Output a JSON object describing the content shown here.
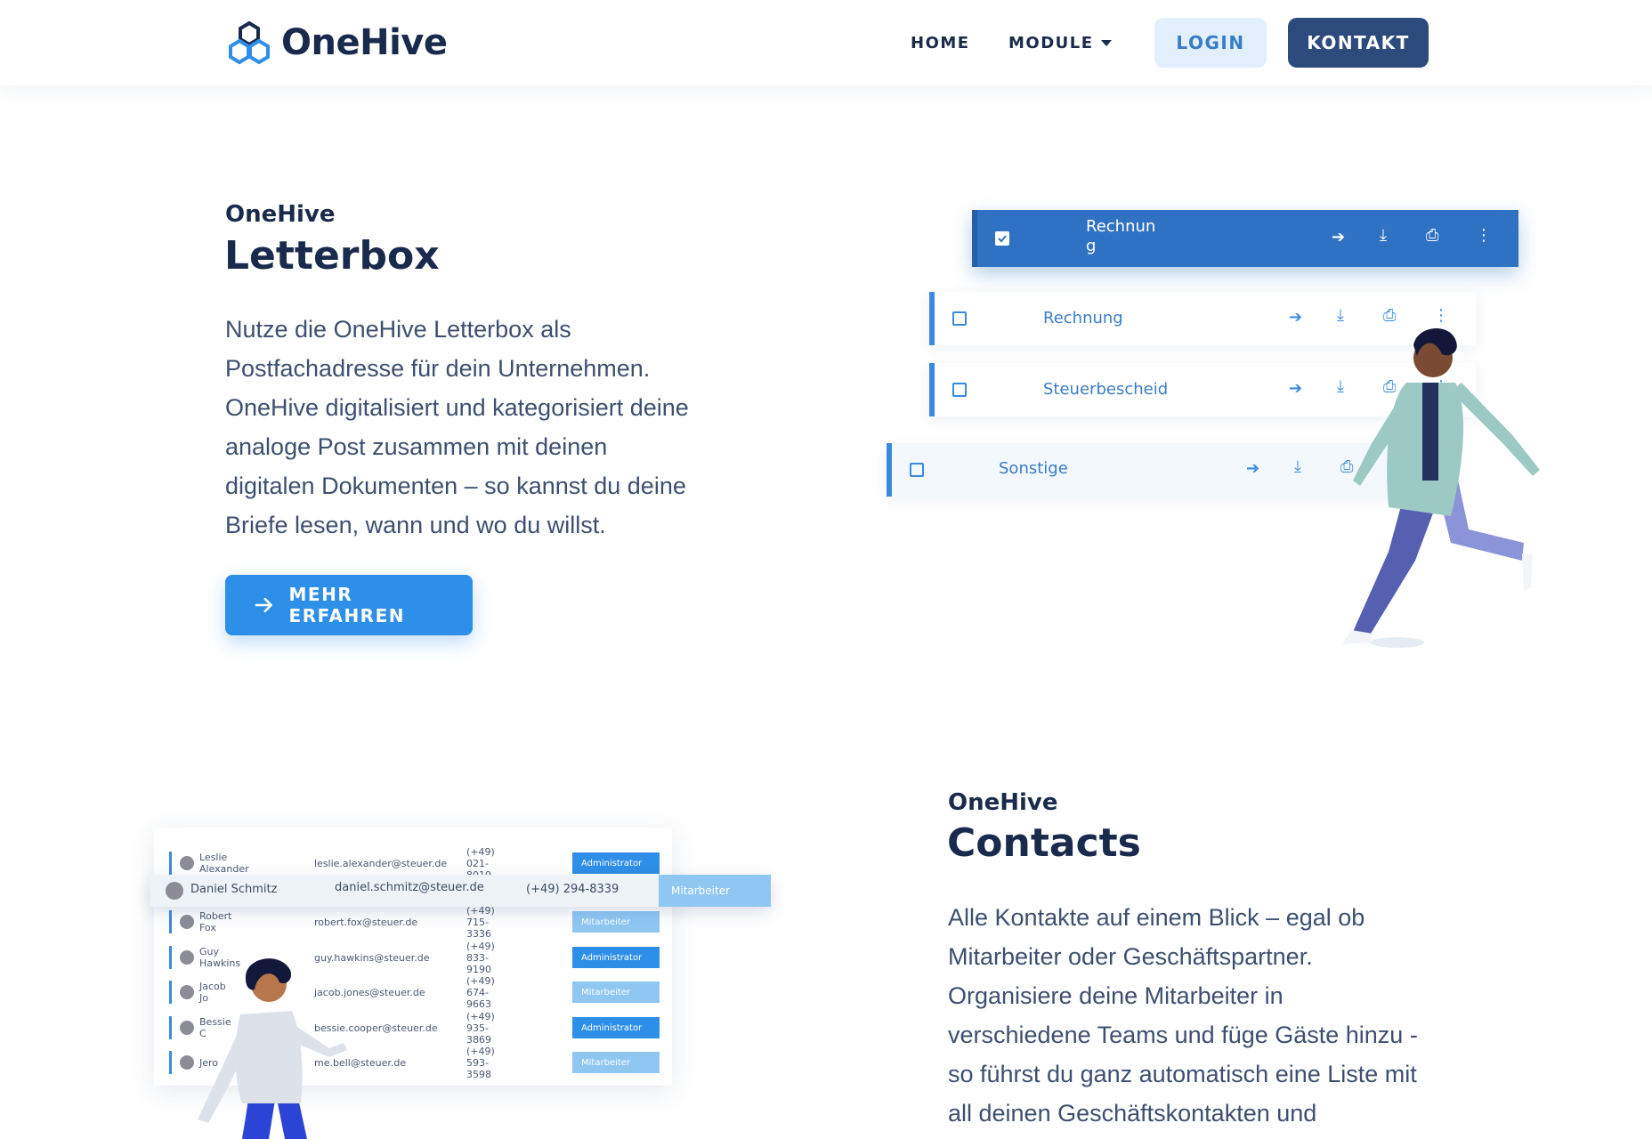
{
  "header": {
    "logo_text": "OneHive",
    "nav": {
      "home": "HOME",
      "module": "MODULE"
    },
    "login": "LOGIN",
    "kontakt": "KONTAKT"
  },
  "letterbox": {
    "eyebrow": "OneHive",
    "title": "Letterbox",
    "lines": [
      "Nutze die OneHive Letterbox als",
      "Postfachadresse für dein Unternehmen.",
      "OneHive digitalisiert und kategorisiert deine",
      "analoge Post zusammen mit deinen",
      "digitalen Dokumenten – so kannst du deine",
      "Briefe lesen, wann und wo du willst."
    ],
    "cta": "MEHR ERFAHREN",
    "docs": {
      "active_line1": "Rechnun",
      "active_line2": "g",
      "row2": "Rechnung",
      "row3": "Steuerbescheid",
      "row4": "Sonstige"
    }
  },
  "contacts": {
    "eyebrow": "OneHive",
    "title": "Contacts",
    "lines": [
      "Alle Kontakte auf einem Blick – egal ob",
      "Mitarbeiter oder Geschäftspartner.",
      "Organisiere deine Mitarbeiter in",
      "verschiedene Teams und füge Gäste hinzu -",
      "so führst du ganz automatisch eine Liste mit",
      "all deinen Geschäftskontakten und"
    ],
    "table": [
      {
        "name": "Leslie Alexander",
        "email": "leslie.alexander@steuer.de",
        "phone": "(+49) 021-8019",
        "role": "Administrator"
      },
      {
        "name": "Robert Fox",
        "email": "robert.fox@steuer.de",
        "phone": "(+49) 715-3336",
        "role": "Mitarbeiter"
      },
      {
        "name": "Guy Hawkins",
        "email": "guy.hawkins@steuer.de",
        "phone": "(+49) 833-9190",
        "role": "Administrator"
      },
      {
        "name": "Jacob Jo",
        "email": "jacob.jones@steuer.de",
        "phone": "(+49) 674-9663",
        "role": "Mitarbeiter"
      },
      {
        "name": "Bessie C",
        "email": "bessie.cooper@steuer.de",
        "phone": "(+49) 935-3869",
        "role": "Administrator"
      },
      {
        "name": "Jero",
        "email": "me.bell@steuer.de",
        "phone": "(+49) 593-3598",
        "role": "Mitarbeiter"
      }
    ],
    "highlight": {
      "name": "Daniel Schmitz",
      "email": "daniel.schmitz@steuer.de",
      "phone": "(+49) 294-8339",
      "role": "Mitarbeiter"
    }
  },
  "colors": {
    "primary": "#2e8fe8",
    "navy": "#1a2a4c",
    "kontakt_bg": "#2c4a7c",
    "login_bg": "#e2effc"
  },
  "icons": [
    "onehive-logo-icon",
    "caret-down-icon",
    "arrow-right-icon",
    "download-icon",
    "print-icon",
    "more-vert-icon",
    "checkbox-icon"
  ]
}
